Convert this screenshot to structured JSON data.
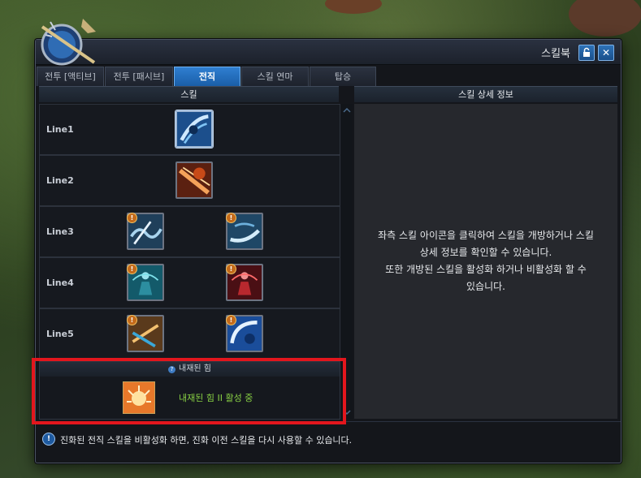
{
  "window": {
    "title": "스킬북",
    "lock_icon": "lock-icon",
    "close_icon": "close-icon"
  },
  "tabs": [
    {
      "label": "전투 [액티브]",
      "active": false
    },
    {
      "label": "전투 [패시브]",
      "active": false
    },
    {
      "label": "전직",
      "active": true
    },
    {
      "label": "스킬 연마",
      "active": false
    },
    {
      "label": "탑승",
      "active": false
    }
  ],
  "columns": {
    "skill": "스킬",
    "detail": "스킬 상세 정보"
  },
  "lines": [
    {
      "label": "Line1",
      "skills": [
        {
          "icon": "blue-slash-skill-icon",
          "locked": false,
          "selected": true
        }
      ]
    },
    {
      "label": "Line2",
      "skills": [
        {
          "icon": "fire-blade-skill-icon",
          "locked": false,
          "selected": false
        }
      ]
    },
    {
      "label": "Line3",
      "skills": [
        {
          "icon": "wave-strike-skill-icon",
          "locked": true
        },
        {
          "icon": "wave-sweep-skill-icon",
          "locked": true
        }
      ]
    },
    {
      "label": "Line4",
      "skills": [
        {
          "icon": "aqua-aura-skill-icon",
          "locked": true
        },
        {
          "icon": "red-aura-skill-icon",
          "locked": true
        }
      ]
    },
    {
      "label": "Line5",
      "skills": [
        {
          "icon": "dual-blade-skill-icon",
          "locked": true
        },
        {
          "icon": "blue-arc-skill-icon",
          "locked": true
        }
      ]
    }
  ],
  "inner_power": {
    "header": "내재된 힘",
    "status": "내재된 힘 II 활성 중"
  },
  "detail": {
    "text": "좌측 스킬 아이콘을 클릭하여 스킬을 개방하거나 스킬\n상세 정보를 확인할 수 있습니다.\n또한 개방된 스킬을 활성화 하거나 비활성화 할 수\n있습니다."
  },
  "footer": {
    "notice": "진화된 전직 스킬을 비활성화 하면, 진화 이전 스킬을 다시 사용할 수 있습니다."
  },
  "colors": {
    "accent": "#1a5ea8",
    "highlight": "#e3161d",
    "active_text": "#88d044"
  }
}
